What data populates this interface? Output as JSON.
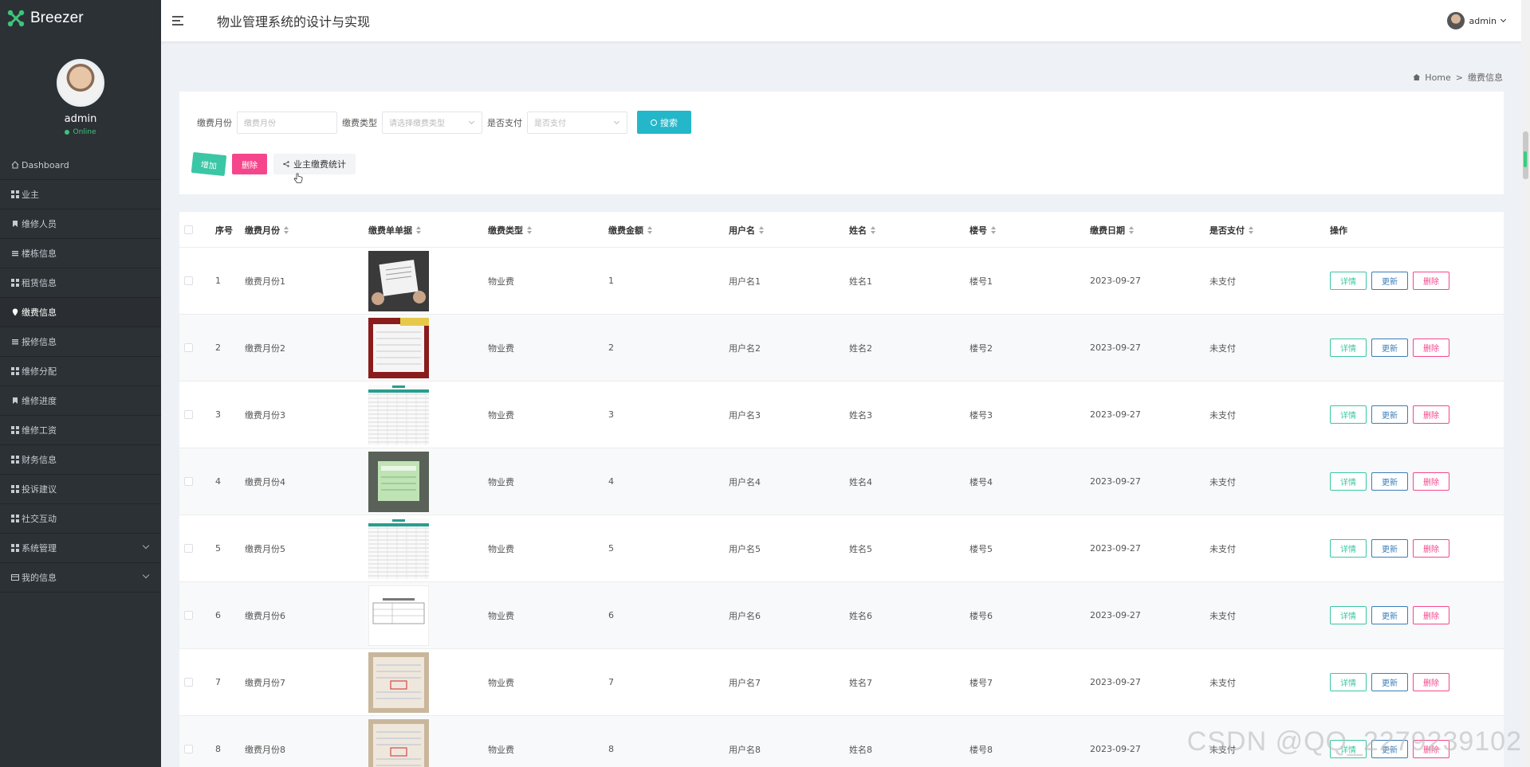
{
  "brand": {
    "name": "Breezer"
  },
  "profile": {
    "name": "admin",
    "status": "Online"
  },
  "sidebar": {
    "items": [
      {
        "label": "Dashboard",
        "icon": "home-icon"
      },
      {
        "label": "业主",
        "icon": "grid-icon"
      },
      {
        "label": "维修人员",
        "icon": "bookmark-icon"
      },
      {
        "label": "楼栋信息",
        "icon": "list-icon"
      },
      {
        "label": "租赁信息",
        "icon": "grid-icon"
      },
      {
        "label": "缴费信息",
        "icon": "pin-icon",
        "active": true
      },
      {
        "label": "报修信息",
        "icon": "list-icon"
      },
      {
        "label": "维修分配",
        "icon": "grid-icon"
      },
      {
        "label": "维修进度",
        "icon": "bookmark-icon"
      },
      {
        "label": "维修工资",
        "icon": "grid-icon"
      },
      {
        "label": "财务信息",
        "icon": "grid-icon"
      },
      {
        "label": "投诉建议",
        "icon": "grid-icon"
      },
      {
        "label": "社交互动",
        "icon": "grid-icon"
      },
      {
        "label": "系统管理",
        "icon": "grid-icon",
        "expandable": true
      },
      {
        "label": "我的信息",
        "icon": "card-icon",
        "expandable": true
      }
    ]
  },
  "header": {
    "title": "物业管理系统的设计与实现",
    "user": "admin"
  },
  "breadcrumb": {
    "home": "Home",
    "separator": ">",
    "current": "缴费信息"
  },
  "search": {
    "month_label": "缴费月份",
    "month_placeholder": "缴费月份",
    "type_label": "缴费类型",
    "type_placeholder": "请选择缴费类型",
    "paid_label": "是否支付",
    "paid_placeholder": "是否支付",
    "search_button": "搜索"
  },
  "actions": {
    "add": "增加",
    "delete": "删除",
    "stats": "业主缴费统计"
  },
  "table": {
    "headers": [
      "序号",
      "缴费月份",
      "缴费单单据",
      "缴费类型",
      "缴费金额",
      "用户名",
      "姓名",
      "楼号",
      "缴费日期",
      "是否支付",
      "操作"
    ],
    "row_buttons": {
      "detail": "详情",
      "update": "更新",
      "delete": "删除"
    },
    "rows": [
      {
        "no": "1",
        "month": "缴费月份1",
        "type": "物业费",
        "amount": "1",
        "username": "用户名1",
        "name": "姓名1",
        "building": "楼号1",
        "date": "2023-09-27",
        "paid": "未支付",
        "thumb": "photo-receipt"
      },
      {
        "no": "2",
        "month": "缴费月份2",
        "type": "物业费",
        "amount": "2",
        "username": "用户名2",
        "name": "姓名2",
        "building": "楼号2",
        "date": "2023-09-27",
        "paid": "未支付",
        "thumb": "red-form"
      },
      {
        "no": "3",
        "month": "缴费月份3",
        "type": "物业费",
        "amount": "3",
        "username": "用户名3",
        "name": "姓名3",
        "building": "楼号3",
        "date": "2023-09-27",
        "paid": "未支付",
        "thumb": "spreadsheet"
      },
      {
        "no": "4",
        "month": "缴费月份4",
        "type": "物业费",
        "amount": "4",
        "username": "用户名4",
        "name": "姓名4",
        "building": "楼号4",
        "date": "2023-09-27",
        "paid": "未支付",
        "thumb": "green-receipt"
      },
      {
        "no": "5",
        "month": "缴费月份5",
        "type": "物业费",
        "amount": "5",
        "username": "用户名5",
        "name": "姓名5",
        "building": "楼号5",
        "date": "2023-09-27",
        "paid": "未支付",
        "thumb": "spreadsheet"
      },
      {
        "no": "6",
        "month": "缴费月份6",
        "type": "物业费",
        "amount": "6",
        "username": "用户名6",
        "name": "姓名6",
        "building": "楼号6",
        "date": "2023-09-27",
        "paid": "未支付",
        "thumb": "white-form"
      },
      {
        "no": "7",
        "month": "缴费月份7",
        "type": "物业费",
        "amount": "7",
        "username": "用户名7",
        "name": "姓名7",
        "building": "楼号7",
        "date": "2023-09-27",
        "paid": "未支付",
        "thumb": "invoice"
      },
      {
        "no": "8",
        "month": "缴费月份8",
        "type": "物业费",
        "amount": "8",
        "username": "用户名8",
        "name": "姓名8",
        "building": "楼号8",
        "date": "2023-09-27",
        "paid": "未支付",
        "thumb": "invoice"
      }
    ]
  },
  "watermark": "CSDN @QQ_2279239102",
  "colors": {
    "sidebar": "#2c3136",
    "accent": "#23b7c9",
    "add": "#3bc6a5",
    "delete": "#f5468c",
    "update": "#3a7db8"
  }
}
